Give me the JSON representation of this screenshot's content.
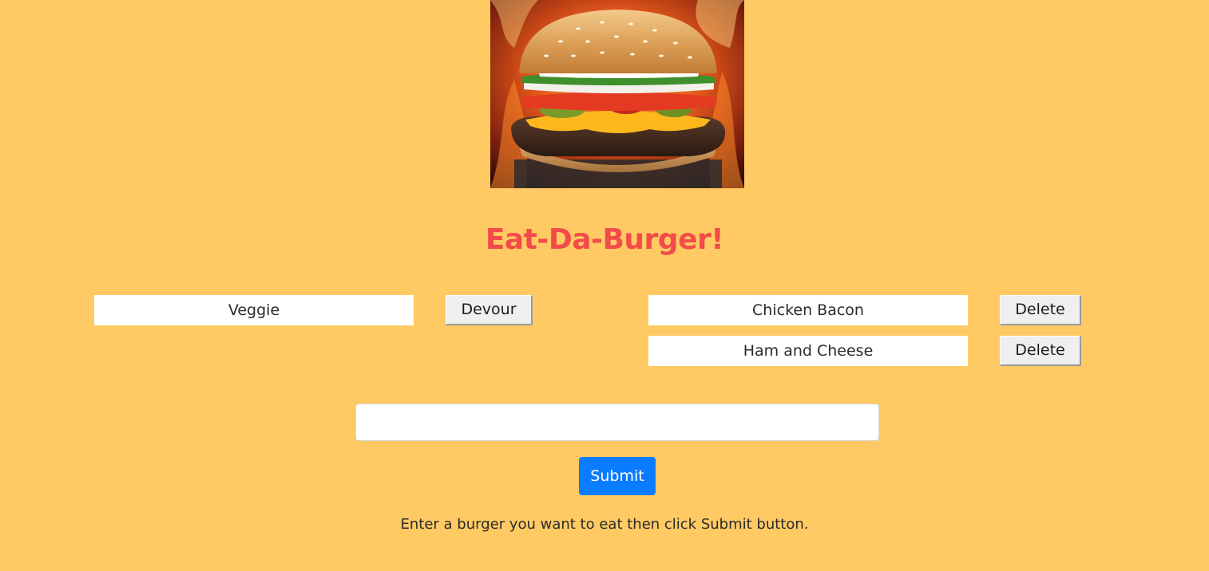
{
  "page": {
    "title": "Eat-Da-Burger!",
    "hint": "Enter a burger you want to eat then click Submit button."
  },
  "colors": {
    "background": "#ffca63",
    "title": "#f34a4a",
    "submit": "#0a7cff"
  },
  "hero_image": {
    "icon": "burger-photo"
  },
  "uneaten": [
    {
      "name": "Veggie",
      "action": "Devour"
    }
  ],
  "devoured": [
    {
      "name": "Chicken Bacon",
      "action": "Delete"
    },
    {
      "name": "Ham and Cheese",
      "action": "Delete"
    }
  ],
  "form": {
    "input_value": "",
    "placeholder": "",
    "submit_label": "Submit"
  }
}
